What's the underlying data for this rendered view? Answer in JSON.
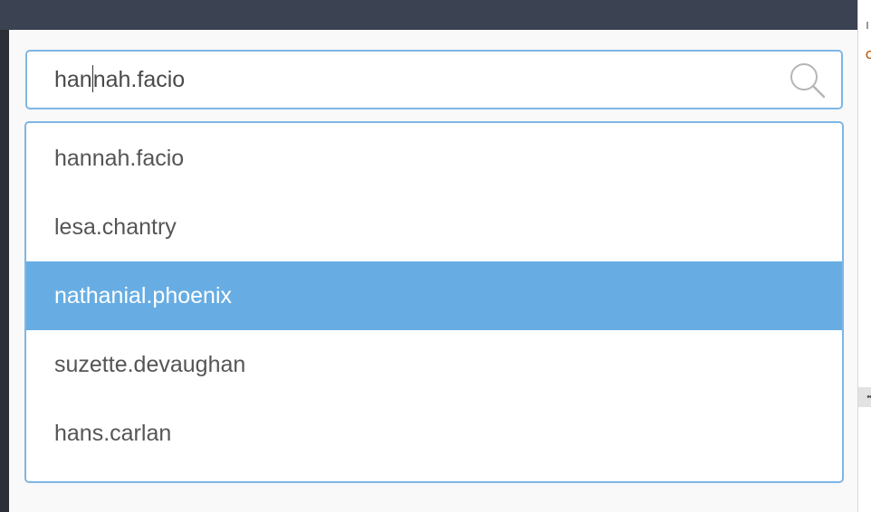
{
  "search": {
    "value_before_caret": "han",
    "value_after_caret": "nah.facio"
  },
  "suggestions": [
    {
      "label": "hannah.facio",
      "selected": false
    },
    {
      "label": "lesa.chantry",
      "selected": false
    },
    {
      "label": "nathanial.phoenix",
      "selected": true
    },
    {
      "label": "suzette.devaughan",
      "selected": false
    },
    {
      "label": "hans.carlan",
      "selected": false
    }
  ],
  "gutter": {
    "mark": "c",
    "scroll_handle": "••"
  },
  "colors": {
    "accent_border": "#7fb6e4",
    "selected_bg": "#67ade3",
    "top_bar": "#3b4252"
  },
  "icons": {
    "search": "search-icon"
  }
}
